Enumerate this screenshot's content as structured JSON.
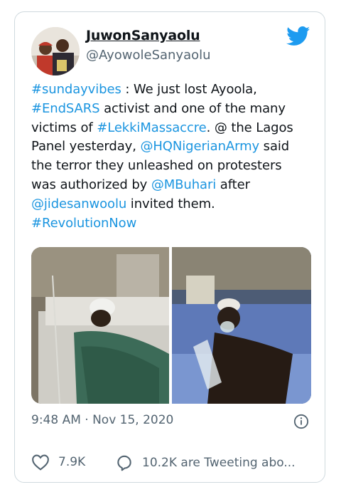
{
  "author": {
    "display_name": "JuwonSanyaolu",
    "handle": "@AyowoleSanyaolu"
  },
  "tweet": {
    "lines": [
      [
        {
          "t": "#sundayvibes",
          "link": true
        },
        {
          "t": " : We just lost Ayoola,",
          "link": false
        }
      ],
      [
        {
          "t": "#EndSARS",
          "link": true
        },
        {
          "t": " activist and one of the many",
          "link": false
        }
      ],
      [
        {
          "t": "victims of ",
          "link": false
        },
        {
          "t": "#LekkiMassaccre",
          "link": true
        },
        {
          "t": ". @ the Lagos",
          "link": false
        }
      ],
      [
        {
          "t": "Panel yesterday, ",
          "link": false
        },
        {
          "t": "@HQNigerianArmy",
          "link": true
        },
        {
          "t": " said",
          "link": false
        }
      ],
      [
        {
          "t": "the terror they unleashed on protesters",
          "link": false
        }
      ],
      [
        {
          "t": "was authorized by ",
          "link": false
        },
        {
          "t": "@MBuhari",
          "link": true
        },
        {
          "t": " after",
          "link": false
        }
      ],
      [
        {
          "t": "@jidesanwoolu",
          "link": true
        },
        {
          "t": " invited them.",
          "link": false
        }
      ],
      [
        {
          "t": "#RevolutionNow",
          "link": true
        }
      ]
    ]
  },
  "timestamp": "9:48 AM · Nov 15, 2020",
  "stats": {
    "likes": "7.9K",
    "tweeting": "10.2K are Tweeting abo..."
  },
  "colors": {
    "link": "#1b95e0",
    "twitter_blue": "#1d9bf0",
    "muted": "#536471",
    "border": "#cfd9de"
  },
  "icons": {
    "brand": "twitter-bird-icon",
    "info": "info-icon",
    "like": "heart-icon",
    "reply": "speech-bubble-icon"
  }
}
